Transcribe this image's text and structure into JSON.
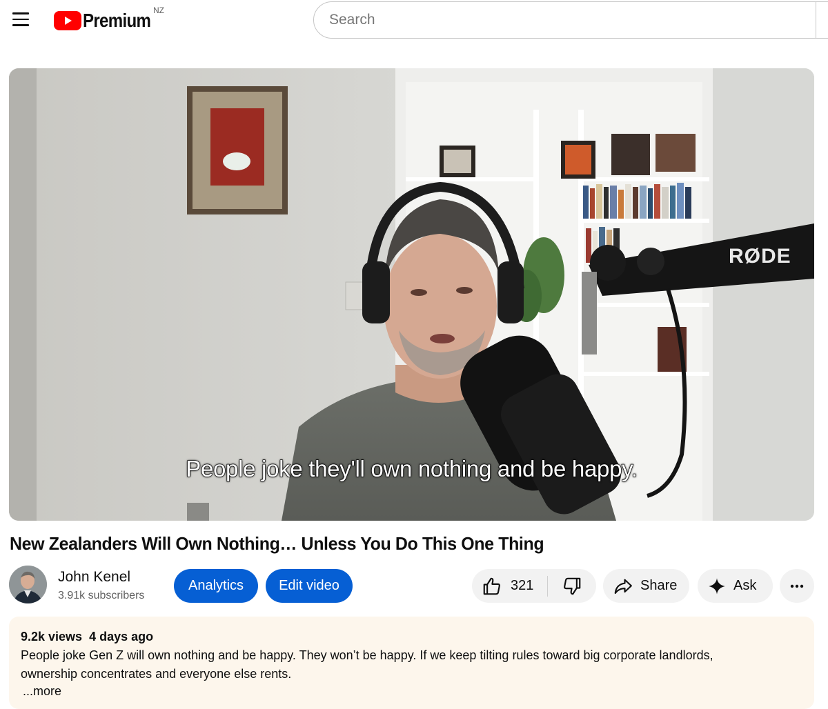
{
  "header": {
    "brand_text": "Premium",
    "country_code": "NZ",
    "search_placeholder": "Search",
    "brand_color": "#ff0000"
  },
  "video": {
    "caption": "People joke they'll own nothing and be happy.",
    "mic_brand": "RØDE"
  },
  "title": "New Zealanders Will Own Nothing… Unless You Do This One Thing",
  "channel": {
    "name": "John Kenel",
    "subscribers": "3.91k subscribers"
  },
  "actions": {
    "analytics": "Analytics",
    "edit_video": "Edit video",
    "like_count": "321",
    "share": "Share",
    "ask": "Ask",
    "accent_color": "#065fd4"
  },
  "description": {
    "views": "9.2k views",
    "date": "4 days ago",
    "text": "People joke Gen Z will own nothing and be happy. They won’t be happy. If we keep tilting rules toward big corporate landlords, ownership concentrates and everyone else rents.",
    "more": "...more"
  },
  "icons": {
    "menu": "hamburger-menu-icon",
    "like": "thumbs-up-icon",
    "dislike": "thumbs-down-icon",
    "share": "share-arrow-icon",
    "ask": "sparkle-icon",
    "more": "more-horizontal-icon"
  }
}
